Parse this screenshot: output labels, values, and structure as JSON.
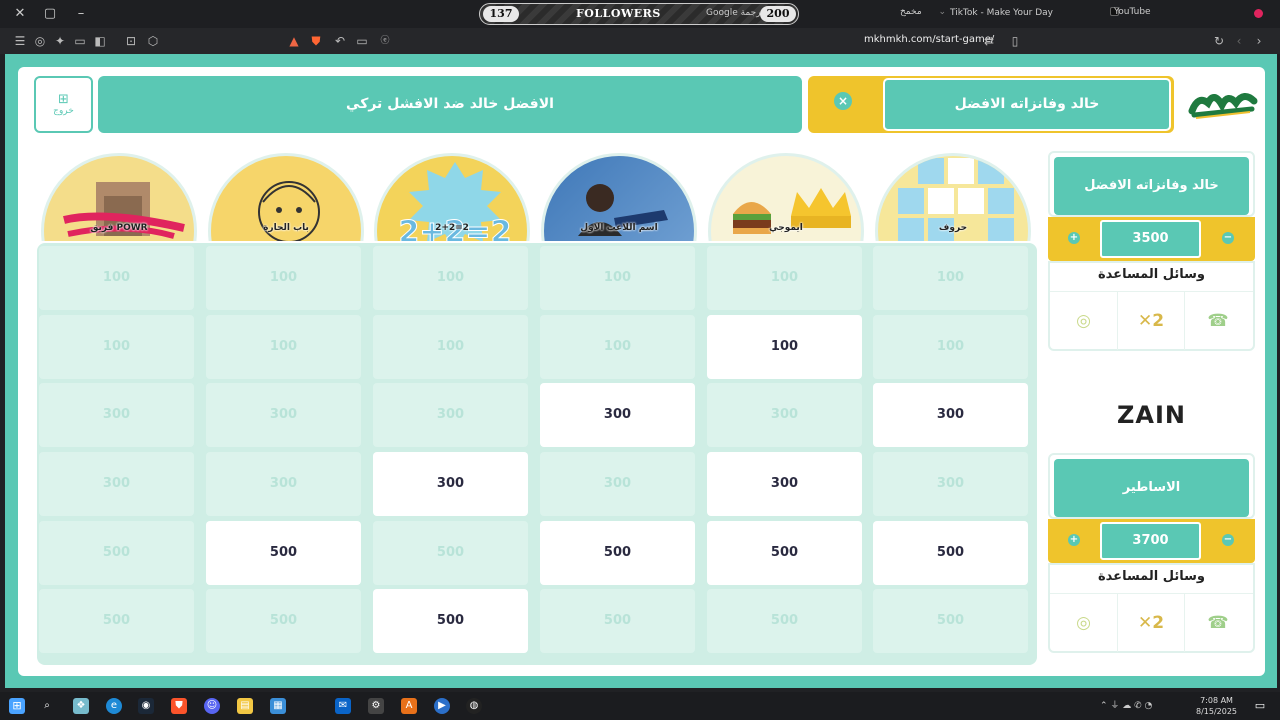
{
  "browser": {
    "followers_label": "FOLLOWERS",
    "followers_left": "137",
    "followers_right": "200",
    "google_translate": "Google ترجمة",
    "tabs": [
      {
        "label": "مخمخ"
      },
      {
        "label": "TikTok - Make Your Day"
      },
      {
        "label": "YouTube"
      }
    ],
    "url": "mkhmkh.com/start-game/"
  },
  "header": {
    "back_label": "خروج",
    "game_title": "الافضل خالد ضد الافشل تركي",
    "turn_team": "خالد وفانزاته الافضل"
  },
  "categories": [
    {
      "label": "حروف"
    },
    {
      "label": "ايموجي"
    },
    {
      "label": "اسم اللاعب الاول"
    },
    {
      "label": "2+2=2"
    },
    {
      "label": "باب الحارة"
    },
    {
      "label": "فريق POWR"
    }
  ],
  "grid": {
    "columns": [
      {
        "cells": [
          {
            "value": "100",
            "state": "used"
          },
          {
            "value": "100",
            "state": "used"
          },
          {
            "value": "300",
            "state": "used"
          },
          {
            "value": "300",
            "state": "used"
          },
          {
            "value": "500",
            "state": "used"
          },
          {
            "value": "500",
            "state": "used"
          }
        ]
      },
      {
        "cells": [
          {
            "value": "100",
            "state": "used"
          },
          {
            "value": "100",
            "state": "used"
          },
          {
            "value": "300",
            "state": "used"
          },
          {
            "value": "300",
            "state": "used"
          },
          {
            "value": "500",
            "state": "open"
          },
          {
            "value": "500",
            "state": "used"
          }
        ]
      },
      {
        "cells": [
          {
            "value": "100",
            "state": "used"
          },
          {
            "value": "100",
            "state": "used"
          },
          {
            "value": "300",
            "state": "used"
          },
          {
            "value": "300",
            "state": "open"
          },
          {
            "value": "500",
            "state": "used"
          },
          {
            "value": "500",
            "state": "open"
          }
        ]
      },
      {
        "cells": [
          {
            "value": "100",
            "state": "used"
          },
          {
            "value": "100",
            "state": "used"
          },
          {
            "value": "300",
            "state": "open"
          },
          {
            "value": "300",
            "state": "used"
          },
          {
            "value": "500",
            "state": "open"
          },
          {
            "value": "500",
            "state": "used"
          }
        ]
      },
      {
        "cells": [
          {
            "value": "100",
            "state": "used"
          },
          {
            "value": "100",
            "state": "open"
          },
          {
            "value": "300",
            "state": "used"
          },
          {
            "value": "300",
            "state": "open"
          },
          {
            "value": "500",
            "state": "open"
          },
          {
            "value": "500",
            "state": "used"
          }
        ]
      },
      {
        "cells": [
          {
            "value": "100",
            "state": "used"
          },
          {
            "value": "100",
            "state": "used"
          },
          {
            "value": "300",
            "state": "open"
          },
          {
            "value": "300",
            "state": "used"
          },
          {
            "value": "500",
            "state": "open"
          },
          {
            "value": "500",
            "state": "used"
          }
        ]
      }
    ]
  },
  "teams": [
    {
      "name": "خالد وفانزاته الافضل",
      "score": "3500",
      "help_title": "وسائل المساعدة"
    },
    {
      "name": "الاساطير",
      "score": "3700",
      "help_title": "وسائل المساعدة"
    }
  ],
  "sponsor": "ZAIN",
  "taskbar": {
    "time": "7:08 AM",
    "date": "8/15/2025"
  },
  "colors": {
    "accent": "#5ac8b4",
    "gold": "#efc42c",
    "used_cell": "#dcf3ec"
  }
}
